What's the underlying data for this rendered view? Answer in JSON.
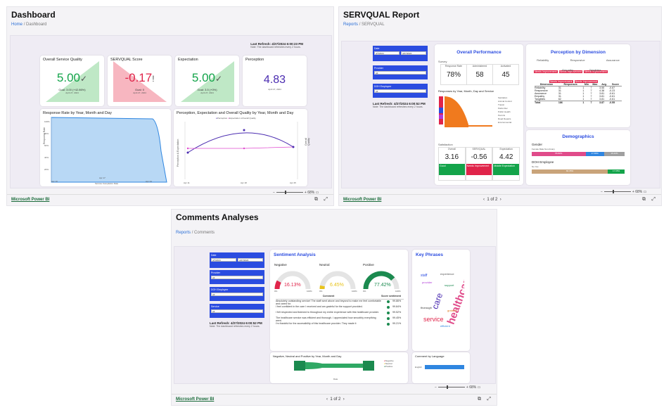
{
  "dashboard": {
    "title": "Dashboard",
    "breadcrumb": {
      "home": "Home",
      "sep": "/",
      "current": "Dashboard"
    },
    "refresh": {
      "label": "Last Refresh: 4/27/2024 6:00:23 PM",
      "note": "Note: The dashboard refreshes every 2 hours."
    },
    "kpis": [
      {
        "title": "Overall Service Quality",
        "value": "5.00",
        "check": "✓",
        "goal": "Goal: 3.00 (+42.86%)",
        "sub": "April 27, 2024",
        "color": "#13a44a"
      },
      {
        "title": "SERVQUAL Score",
        "value": "-0.17",
        "check": "!",
        "goal": "Goal: 0",
        "sub": "April 27, 2024",
        "color": "#e0244a"
      },
      {
        "title": "Expectation",
        "value": "5.00",
        "check": "✓",
        "goal": "Goal: 3.5 (+0%)",
        "sub": "April 27, 2024",
        "color": "#13a44a"
      },
      {
        "title": "Perception",
        "value": "4.83",
        "sub": "April 27, 2024",
        "color": "#4a2bb0"
      }
    ],
    "response_chart": {
      "title": "Response Rate by Year, Month and Day",
      "ylabel": "Response Rate",
      "xlabel": "Service Completion Date",
      "yticks": [
        "100%",
        "80%",
        "60%",
        "40%",
        "20%"
      ],
      "xticks": [
        "Apr 10",
        "Apr 17",
        "Apr 24"
      ]
    },
    "perception_chart": {
      "title": "Perception, Expectation and Overall Quality by Year, Month and Day",
      "legend": [
        "Perception",
        "Expectation",
        "Overall Quality"
      ],
      "ylabel_left": "Perception & Expectation",
      "ylabel_right": "Overall Quality",
      "xticks": [
        "Apr 11",
        "Apr 18",
        "Apr 25"
      ]
    },
    "zoom": "68%",
    "footer_link": "Microsoft Power BI"
  },
  "servqual": {
    "title": "SERVQUAL Report",
    "breadcrumb": {
      "home": "Reports",
      "sep": "/",
      "current": "SERVQUAL"
    },
    "slicers": [
      {
        "label": "Date",
        "v1": "4/7/2024",
        "v2": "4/27/2024"
      },
      {
        "label": "Provider",
        "v1": "All"
      },
      {
        "label": "DOH Employee",
        "v1": "All"
      }
    ],
    "refresh": {
      "label": "Last Refresh: 4/27/2024 6:00:52 PM",
      "note": "Note: The dashboard refreshes every 2 hours."
    },
    "overall": {
      "title": "Overall Performance",
      "survey": "Survey",
      "cols": [
        "Response Rate",
        "Administered",
        "Activated"
      ],
      "vals": [
        "78%",
        "58",
        "45"
      ]
    },
    "resp_title": "Responses by Year, Month, Day and Service",
    "resp_legend": [
      "Sanitation",
      "Animal Control",
      "Transit",
      "Parks Rec",
      "Public Health",
      "Permits",
      "Road Repairs",
      "Environmental"
    ],
    "satisfaction": {
      "title": "Satisfaction",
      "cols": [
        "Overall",
        "SERVQUAL",
        "Expectation"
      ],
      "vals": [
        "3.16",
        "-0.56",
        "4.42"
      ],
      "tags": [
        "Good",
        "Needs Improvement",
        "Middle Expectation"
      ]
    },
    "perception": {
      "title": "Perception by Dimension",
      "dims_top": [
        "Reliability",
        "Responsive",
        "Assurance"
      ],
      "tags_top": [
        "Needs Improvement",
        "Needs Improvement",
        "Needs Improvement"
      ],
      "dims_mid": [
        "Empathy",
        "Tangibles"
      ],
      "tags_mid": [
        "Needs Improvement",
        "Needs Improvement"
      ],
      "table_head": [
        "Dimension",
        "Responses",
        "Min",
        "Max",
        "Avg.",
        "Score"
      ],
      "rows": [
        [
          "Reliability",
          "31",
          "1",
          "7",
          "3.55",
          "-0.87"
        ],
        [
          "Responsive",
          "31",
          "1",
          "7",
          "4.38",
          "-0.23"
        ],
        [
          "Assurance",
          "31",
          "1",
          "7",
          "3.81",
          "-0.61"
        ],
        [
          "Empathy",
          "31",
          "1",
          "7",
          "3.81",
          "-0.61"
        ],
        [
          "Tangibles",
          "62",
          "1",
          "7",
          "3.81",
          "-0.61"
        ]
      ],
      "total": [
        "Total",
        "186",
        "1",
        "7",
        "3.87",
        "-0.55"
      ]
    },
    "demographics": {
      "title": "Demographics",
      "gender": "Gender",
      "gender_legend": "Female  Male  Non-binary",
      "gender_vals": [
        "55.82%",
        "17.65%",
        "16.42%"
      ],
      "doh": "DOH Employee",
      "doh_legend": "No  Yes",
      "doh_vals": [
        "82.35%",
        "17.65%"
      ]
    },
    "zoom": "68%",
    "pager": "1 of 2",
    "footer_link": "Microsoft Power BI"
  },
  "comments": {
    "title": "Comments Analyses",
    "breadcrumb": {
      "home": "Reports",
      "sep": "/",
      "current": "Comments"
    },
    "slicers": [
      {
        "label": "Date",
        "v1": "4/7/2024",
        "v2": "4/27/2024"
      },
      {
        "label": "Provider",
        "v1": "All"
      },
      {
        "label": "DOH Employee",
        "v1": "All"
      },
      {
        "label": "Service",
        "v1": "All"
      }
    ],
    "refresh": {
      "label": "Last Refresh: 4/27/2024 6:00:52 PM",
      "note": "Note: The dashboard refreshes every 2 hours."
    },
    "sentiment": {
      "title": "Sentiment Analysis",
      "gauges": [
        {
          "label": "Negative",
          "value": "16.13%",
          "pct": 0.1613,
          "color": "#e0244a"
        },
        {
          "label": "Neutral",
          "value": "6.45%",
          "pct": 0.0645,
          "color": "#e8c31c"
        },
        {
          "label": "Positive",
          "value": "77.42%",
          "pct": 0.7742,
          "color": "#1b8a4f"
        }
      ],
      "gauge_min": "0%",
      "gauge_max": "100%",
      "table_head": [
        "Comment",
        "Score sentiment"
      ],
      "rows": [
        [
          "Absolutely outstanding service! The staff went above and beyond to make me feel comfortable and cared for.",
          "99.86%"
        ],
        [
          "I feel confident in the care I received and am grateful for the support provided.",
          "99.84%"
        ],
        [
          "I felt respected and listened to throughout my entire experience with this healthcare provider.",
          "99.52%"
        ],
        [
          "The healthcare service was efficient and thorough. I appreciated how smoothly everything went.",
          "99.45%"
        ],
        [
          "I'm thankful for the accessibility of this healthcare provider. They made it",
          "99.21%"
        ]
      ]
    },
    "keyphrases": {
      "title": "Key Phrases",
      "words": [
        "healthcare",
        "care",
        "service",
        "staff",
        "experience",
        "provider",
        "support",
        "grateful",
        "thorough",
        "efficient"
      ]
    },
    "trend": {
      "title": "Negative, Neutral and Positive by Year, Month and Day",
      "legend": [
        "Negative",
        "Neutral",
        "Positive"
      ],
      "xlabel": "Date"
    },
    "language": {
      "title": "Comment by Language",
      "category": "English"
    },
    "zoom": "68%",
    "pager": "1 of 2",
    "footer_link": "Microsoft Power BI"
  }
}
